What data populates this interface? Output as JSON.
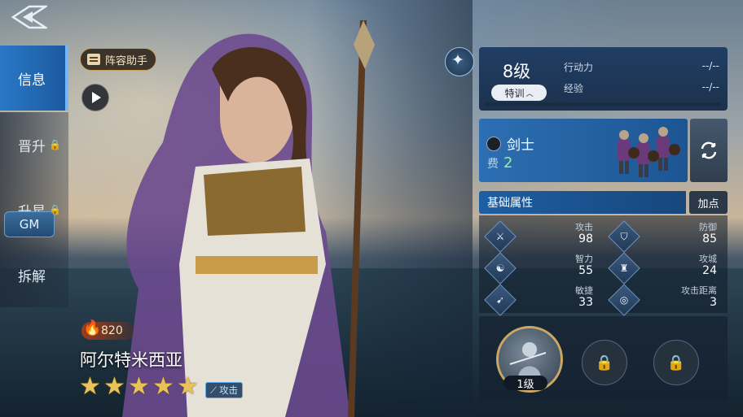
{
  "sidebar": {
    "items": [
      {
        "label": "信息",
        "locked": false
      },
      {
        "label": "晋升",
        "locked": true
      },
      {
        "label": "升星",
        "locked": true
      },
      {
        "label": "拆解",
        "locked": false
      }
    ],
    "gm_label": "GM"
  },
  "hero": {
    "helper_label": "阵容助手",
    "power": "820",
    "name": "阿尔特米西亚",
    "stars": 5,
    "role_tag": "攻击"
  },
  "level": {
    "value": "8级",
    "train_label": "特训",
    "rows": [
      {
        "label": "行动力",
        "value": "--/--"
      },
      {
        "label": "经验",
        "value": "--/--"
      }
    ]
  },
  "unit": {
    "name": "剑士",
    "cost_label": "费",
    "cost_value": "2"
  },
  "attributes": {
    "title": "基础属性",
    "add_points_label": "加点",
    "items": [
      {
        "label": "攻击",
        "value": "98",
        "icon": "sword-icon"
      },
      {
        "label": "防御",
        "value": "85",
        "icon": "shield-icon"
      },
      {
        "label": "智力",
        "value": "55",
        "icon": "brain-icon"
      },
      {
        "label": "攻城",
        "value": "24",
        "icon": "castle-icon"
      },
      {
        "label": "敏捷",
        "value": "33",
        "icon": "boot-icon"
      },
      {
        "label": "攻击距离",
        "value": "3",
        "icon": "range-icon"
      }
    ]
  },
  "skills": {
    "main_level": "1级",
    "locked_count": 2
  },
  "colors": {
    "accent": "#2a78c6",
    "gold": "#e9c25a",
    "cost_green": "#9de8a0"
  }
}
